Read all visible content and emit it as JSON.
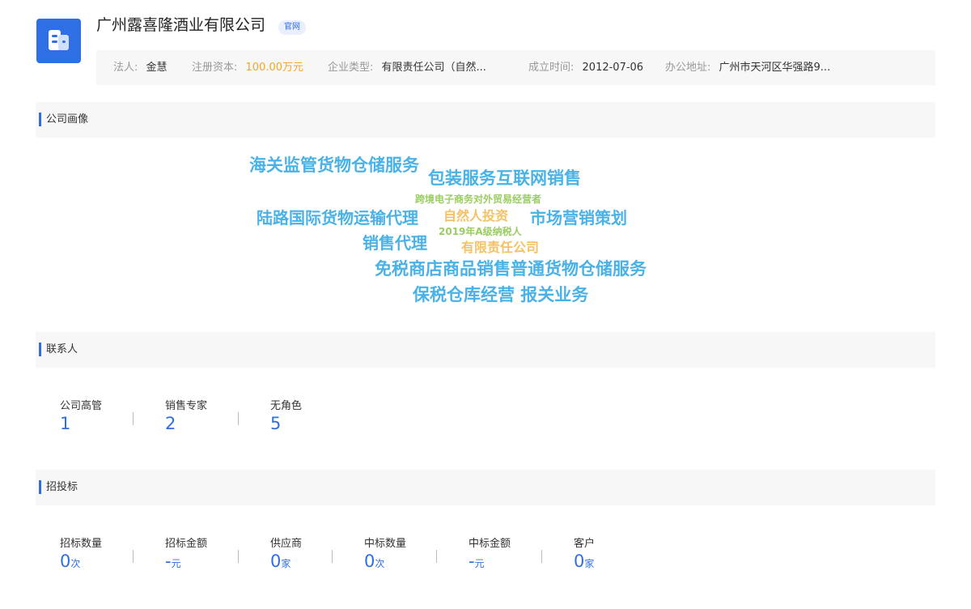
{
  "company": {
    "name": "广州露喜隆酒业有限公司",
    "official_tag": "官网",
    "logo_icon": "building-icon"
  },
  "info": {
    "legal_rep_label": "法人:",
    "legal_rep_value": "金慧",
    "capital_label": "注册资本:",
    "capital_value": "100.00万元",
    "type_label": "企业类型:",
    "type_value": "有限责任公司（自然...",
    "founded_label": "成立时间:",
    "founded_value": "2012-07-06",
    "address_label": "办公地址:",
    "address_value": "广州市天河区华强路9...",
    "accent_color": "#f5a623"
  },
  "portrait": {
    "title": "公司画像",
    "tags": [
      "海关监管货物仓储服务",
      "包装服务互联网销售",
      "跨境电子商务对外贸易经营者",
      "陆路国际货物运输代理",
      "自然人投资",
      "市场营销策划",
      "2019年A级纳税人",
      "销售代理",
      "有限责任公司",
      "免税商店商品销售普通货物仓储服务",
      "保税仓库经营 报关业务"
    ],
    "colors": {
      "blue": "#4ab2e6",
      "green": "#9acd62",
      "orange": "#f4c265"
    }
  },
  "contacts": {
    "title": "联系人",
    "stats": [
      {
        "label": "公司高管",
        "value": "1"
      },
      {
        "label": "销售专家",
        "value": "2"
      },
      {
        "label": "无角色",
        "value": "5"
      }
    ]
  },
  "bidding": {
    "title": "招投标",
    "stats": [
      {
        "label": "招标数量",
        "value": "0",
        "unit": "次"
      },
      {
        "label": "招标金额",
        "value": "-",
        "unit": "元"
      },
      {
        "label": "供应商",
        "value": "0",
        "unit": "家"
      },
      {
        "label": "中标数量",
        "value": "0",
        "unit": "次"
      },
      {
        "label": "中标金额",
        "value": "-",
        "unit": "元"
      },
      {
        "label": "客户",
        "value": "0",
        "unit": "家"
      }
    ]
  },
  "brand_color": "#2f6fe6"
}
